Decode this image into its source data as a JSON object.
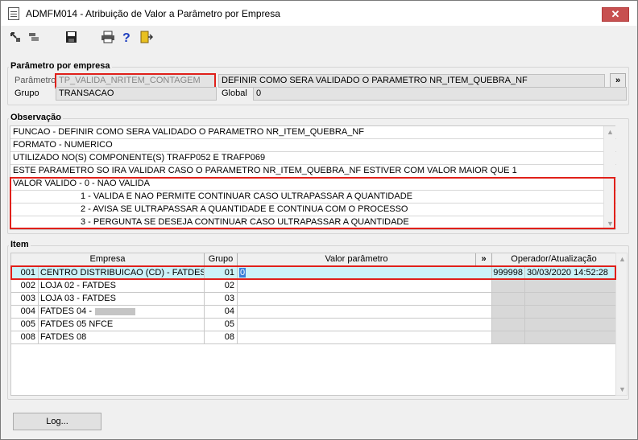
{
  "window": {
    "title": "ADMFM014 - Atribuição de Valor a Parâmetro por Empresa",
    "close_label": "✕"
  },
  "toolbar": {
    "icons": [
      "first-record-icon",
      "grid-icon",
      "save-icon",
      "print-icon",
      "help-icon",
      "exit-icon"
    ]
  },
  "param_group": {
    "legend": "Parâmetro por empresa",
    "param_label": "Parâmetro",
    "param_value": "TP_VALIDA_NRITEM_CONTAGEM",
    "param_desc": "DEFINIR COMO SERA VALIDADO O PARAMETRO NR_ITEM_QUEBRA_NF",
    "expand_label": "»",
    "grupo_label": "Grupo",
    "grupo_value": "TRANSACAO",
    "global_label": "Global",
    "global_value": "0"
  },
  "obs_group": {
    "legend": "Observação",
    "lines": [
      "FUNCAO - DEFINIR COMO SERA VALIDADO O PARAMETRO NR_ITEM_QUEBRA_NF",
      "FORMATO - NUMERICO",
      "UTILIZADO NO(S) COMPONENTE(S) TRAFP052 E TRAFP069",
      "ESTE PARAMETRO SO IRA VALIDAR CASO O PARAMETRO NR_ITEM_QUEBRA_NF ESTIVER COM VALOR MAIOR QUE 1",
      "VALOR VALIDO - 0 - NAO VALIDA",
      "1 - VALIDA E NAO PERMITE CONTINUAR CASO ULTRAPASSAR A QUANTIDADE",
      "2 - AVISA SE ULTRAPASSAR A QUANTIDADE E CONTINUA COM O PROCESSO",
      "3 - PERGUNTA SE DESEJA CONTINUAR CASO ULTRAPASSAR A QUANTIDADE"
    ]
  },
  "item_group": {
    "legend": "Item",
    "headers": {
      "empresa": "Empresa",
      "grupo": "Grupo",
      "valor": "Valor parâmetro",
      "expand": "»",
      "operador": "Operador/Atualização"
    },
    "rows": [
      {
        "code": "001",
        "name": "CENTRO DISTRIBUICAO (CD) - FATDES",
        "grupo": "01",
        "valor": "0",
        "operador": "999998",
        "data": "30/03/2020 14:52:28"
      },
      {
        "code": "002",
        "name": "LOJA 02 - FATDES",
        "grupo": "02",
        "valor": "",
        "operador": "",
        "data": ""
      },
      {
        "code": "003",
        "name": "LOJA 03 - FATDES",
        "grupo": "03",
        "valor": "",
        "operador": "",
        "data": ""
      },
      {
        "code": "004",
        "name": "FATDES 04 -",
        "grupo": "04",
        "valor": "",
        "operador": "",
        "data": ""
      },
      {
        "code": "005",
        "name": "FATDES 05 NFCE",
        "grupo": "05",
        "valor": "",
        "operador": "",
        "data": ""
      },
      {
        "code": "008",
        "name": "FATDES 08",
        "grupo": "08",
        "valor": "",
        "operador": "",
        "data": ""
      }
    ]
  },
  "buttons": {
    "log": "Log..."
  },
  "colors": {
    "highlight_box": "#e0201a",
    "selected_row": "#ccf2f8",
    "close_button": "#c75050"
  }
}
